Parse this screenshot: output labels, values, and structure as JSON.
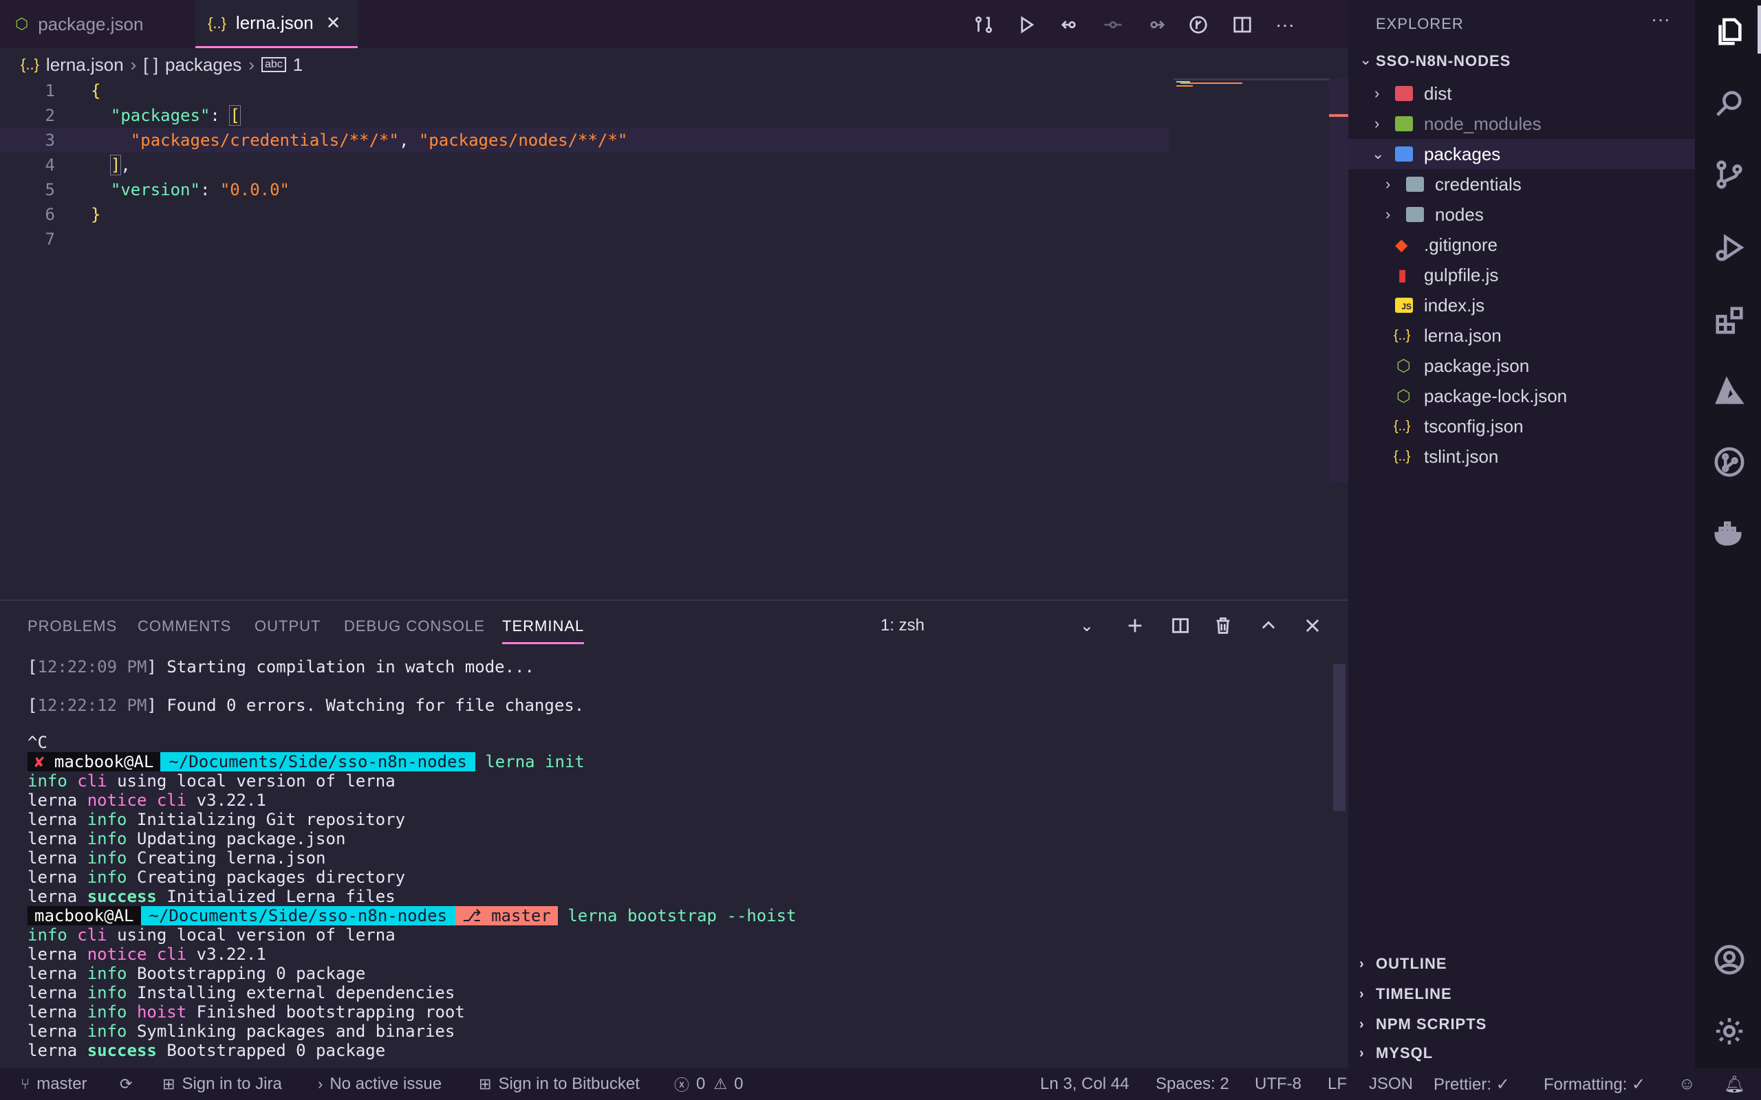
{
  "tabs": [
    {
      "label": "package.json",
      "icon": "nodejs-icon"
    },
    {
      "label": "lerna.json",
      "icon": "json-braces-icon"
    }
  ],
  "breadcrumb": {
    "file": "lerna.json",
    "key": "packages",
    "index": "1"
  },
  "code": {
    "line_numbers": [
      "1",
      "2",
      "3",
      "4",
      "5",
      "6",
      "7"
    ],
    "packages_key": "\"packages\"",
    "creds_path": "\"packages/credentials/**/*\"",
    "nodes_path": "\"packages/nodes/**/*\"",
    "version_key": "\"version\"",
    "version_value": "\"0.0.0\""
  },
  "panel": {
    "tabs": [
      "PROBLEMS",
      "COMMENTS",
      "OUTPUT",
      "DEBUG CONSOLE",
      "TERMINAL"
    ],
    "terminal_select": "1: zsh"
  },
  "terminal": {
    "t1": "12:22:09 PM",
    "m1": "Starting compilation in watch mode...",
    "t2": "12:22:12 PM",
    "m2": "Found 0 errors. Watching for file changes.",
    "ctrlc": "^C",
    "user": "macbook@AL",
    "path": "~/Documents/Side/sso-n8n-nodes",
    "branch": "master",
    "cmd1": "lerna init",
    "cmd2": "lerna bootstrap --hoist",
    "using_local": "using local version of lerna",
    "version": "v3.22.1",
    "init_lines": [
      "Initializing Git repository",
      "Updating package.json",
      "Creating lerna.json",
      "Creating packages directory"
    ],
    "init_success": "Initialized Lerna files",
    "boot_lines": [
      "Bootstrapping 0 package",
      "Installing external dependencies"
    ],
    "hoist_msg": "Finished bootstrapping root",
    "symlink": "Symlinking packages and binaries",
    "boot_success": "Bootstrapped 0 package"
  },
  "explorer": {
    "title": "EXPLORER",
    "workspace": "SSO-N8N-NODES",
    "items": [
      {
        "name": "dist",
        "type": "folder"
      },
      {
        "name": "node_modules",
        "type": "folder"
      },
      {
        "name": "packages",
        "type": "folder-open"
      },
      {
        "name": "credentials",
        "type": "folder"
      },
      {
        "name": "nodes",
        "type": "folder"
      },
      {
        "name": ".gitignore",
        "type": "git"
      },
      {
        "name": "gulpfile.js",
        "type": "gulp"
      },
      {
        "name": "index.js",
        "type": "js"
      },
      {
        "name": "lerna.json",
        "type": "json"
      },
      {
        "name": "package.json",
        "type": "node"
      },
      {
        "name": "package-lock.json",
        "type": "node"
      },
      {
        "name": "tsconfig.json",
        "type": "json"
      },
      {
        "name": "tslint.json",
        "type": "json"
      }
    ],
    "sections": [
      "OUTLINE",
      "TIMELINE",
      "NPM SCRIPTS",
      "MYSQL"
    ]
  },
  "status": {
    "branch": "master",
    "jira": "Sign in to Jira",
    "issue": "No active issue",
    "bitbucket": "Sign in to Bitbucket",
    "errors": "0",
    "warnings": "0",
    "position": "Ln 3, Col 44",
    "spaces": "Spaces: 2",
    "encoding": "UTF-8",
    "eol": "LF",
    "language": "JSON",
    "prettier": "Prettier: ✓",
    "formatting": "Formatting: ✓"
  },
  "colors": {
    "accent": "#ff7edb",
    "key": "#72f1b8",
    "string": "#ff8b39",
    "path_segment": "#00d8ea",
    "git_segment": "#f97e72"
  }
}
